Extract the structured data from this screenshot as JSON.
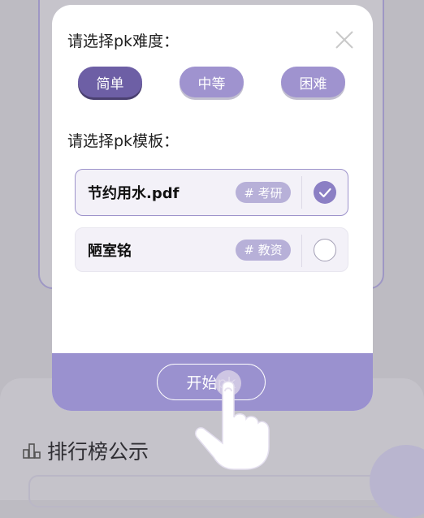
{
  "background": {
    "ranking_title": "排行榜公示"
  },
  "dialog": {
    "difficulty_label": "请选择pk难度：",
    "difficulty_options": [
      {
        "label": "简单",
        "selected": true
      },
      {
        "label": "中等",
        "selected": false
      },
      {
        "label": "困难",
        "selected": false
      }
    ],
    "template_label": "请选择pk模板：",
    "templates": [
      {
        "name": "节约用水.pdf",
        "tag": "# 考研",
        "checked": true
      },
      {
        "name": "陋室铭",
        "tag": "# 教资",
        "checked": false
      }
    ],
    "start_button": "开始pk"
  },
  "colors": {
    "accent": "#9a91cf",
    "selected_button": "#6d5fa5",
    "tag": "#b7b0d8"
  }
}
